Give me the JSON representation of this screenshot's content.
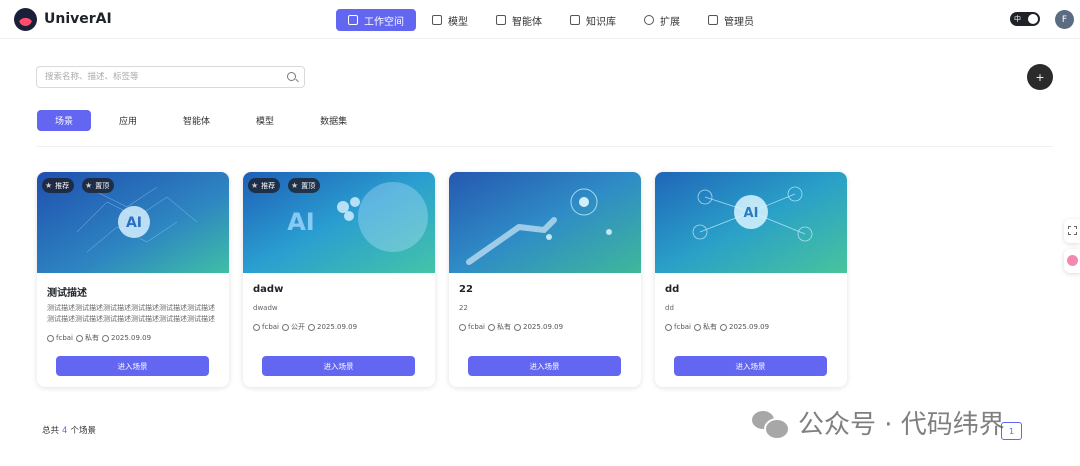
{
  "app": {
    "name": "UniverAI"
  },
  "nav": [
    {
      "label": "工作空间",
      "icon": "monitor-icon",
      "active": true
    },
    {
      "label": "模型",
      "icon": "cube-icon",
      "active": false
    },
    {
      "label": "智能体",
      "icon": "phone-icon",
      "active": false
    },
    {
      "label": "知识库",
      "icon": "book-icon",
      "active": false
    },
    {
      "label": "扩展",
      "icon": "plus-circle-icon",
      "active": false
    },
    {
      "label": "管理员",
      "icon": "admin-icon",
      "active": false
    }
  ],
  "language_toggle": "中",
  "user": {
    "avatar_letter": "F"
  },
  "search": {
    "placeholder": "搜索名称、描述、标签等",
    "value": ""
  },
  "add_button": "+",
  "tabs": [
    {
      "label": "场景",
      "active": true
    },
    {
      "label": "应用",
      "active": false
    },
    {
      "label": "智能体",
      "active": false
    },
    {
      "label": "模型",
      "active": false
    },
    {
      "label": "数据集",
      "active": false
    }
  ],
  "cards": [
    {
      "title": "测试描述",
      "description": "测试描述测试描述测试描述测试描述测试描述测试描述测试描述测试描述测试描述测试描述测试描述测试描述测...",
      "badges": [
        "推荐",
        "置顶"
      ],
      "author": "fcbai",
      "visibility": "私有",
      "date": "2025.09.09",
      "button": "进入场景"
    },
    {
      "title": "dadw",
      "description": "dwadw",
      "badges": [
        "推荐",
        "置顶"
      ],
      "author": "fcbai",
      "visibility": "公开",
      "date": "2025.09.09",
      "button": "进入场景"
    },
    {
      "title": "22",
      "description": "22",
      "badges": [],
      "author": "fcbai",
      "visibility": "私有",
      "date": "2025.09.09",
      "button": "进入场景"
    },
    {
      "title": "dd",
      "description": "dd",
      "badges": [],
      "author": "fcbai",
      "visibility": "私有",
      "date": "2025.09.09",
      "button": "进入场景"
    }
  ],
  "footer": {
    "total_prefix": "总共",
    "total_count": "4",
    "total_suffix": "个场景",
    "current_page": "1"
  },
  "watermark": "公众号 · 代码纬界",
  "colors": {
    "primary": "#6366f1",
    "dark": "#1f2329"
  }
}
